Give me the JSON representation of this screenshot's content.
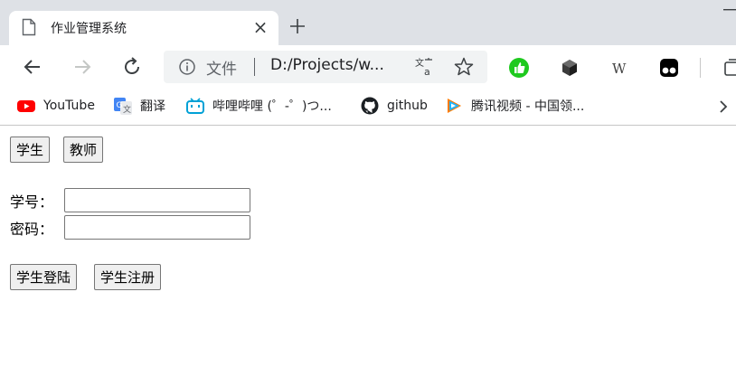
{
  "browser": {
    "tab": {
      "title": "作业管理系统"
    },
    "address": {
      "scheme_label": "文件",
      "url": "D:/Projects/w..."
    },
    "bookmarks": [
      {
        "label": "YouTube",
        "icon": "youtube-icon"
      },
      {
        "label": "翻译",
        "icon": "google-translate-icon"
      },
      {
        "label": "哔哩哔哩 (゜-゜)つ...",
        "icon": "bilibili-icon"
      },
      {
        "label": "github",
        "icon": "github-icon"
      },
      {
        "label": "腾讯视频 - 中国领...",
        "icon": "tencent-video-icon"
      }
    ]
  },
  "page": {
    "role_buttons": {
      "student": "学生",
      "teacher": "教师"
    },
    "form": {
      "id_label": "学号：",
      "id_value": "",
      "password_label": "密码：",
      "password_value": ""
    },
    "actions": {
      "login": "学生登陆",
      "register": "学生注册"
    }
  },
  "colors": {
    "tabstrip_bg": "#dee1e6",
    "omnibox_bg": "#f1f3f4",
    "button_bg": "#efefef",
    "extension_green": "#1ec91e"
  }
}
